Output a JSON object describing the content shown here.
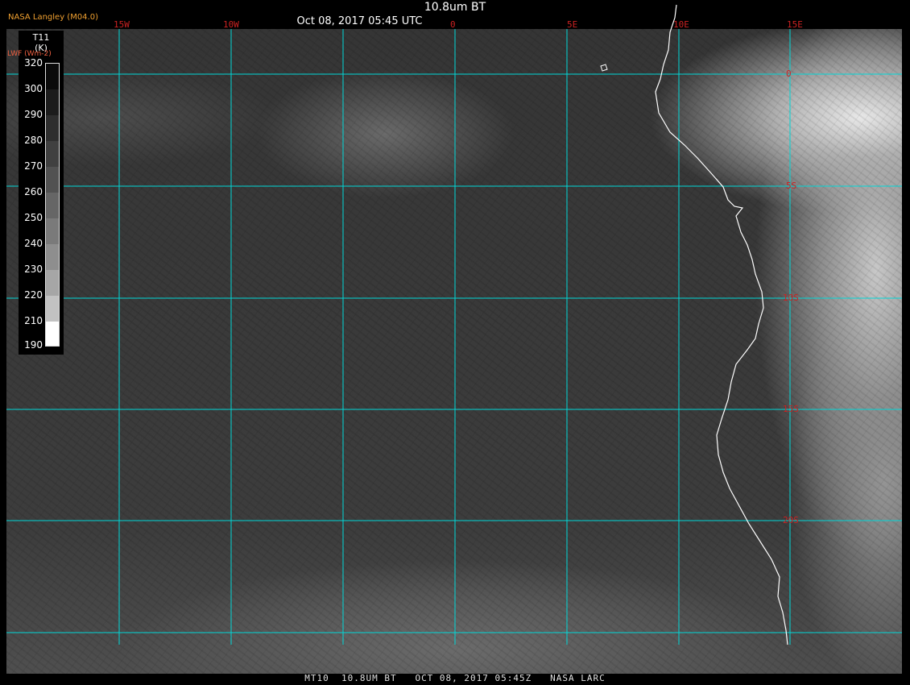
{
  "header": {
    "title": "10.8um BT",
    "subtitle": "Oct 08, 2017 05:45 UTC",
    "provider": "NASA Langley (M04.0)",
    "lwf_label": "LWF (Wm-2)"
  },
  "legend": {
    "title_line1": "T11",
    "title_line2": "(K)",
    "ticks": [
      "320",
      "300",
      "290",
      "280",
      "270",
      "260",
      "250",
      "240",
      "230",
      "220",
      "210",
      "190"
    ]
  },
  "map": {
    "longitude_labels": [
      "15W",
      "10W",
      "0",
      "5E",
      "10E",
      "15E"
    ],
    "latitude_labels": [
      "0",
      "5S",
      "10S",
      "15S",
      "20S"
    ],
    "colors": {
      "gridline": "#00d8d8",
      "coastline": "#ffffff",
      "grid_label": "#cc2222"
    }
  },
  "footer": {
    "text": "MT10  10.8UM BT   OCT 08, 2017 05:45Z   NASA LARC"
  }
}
